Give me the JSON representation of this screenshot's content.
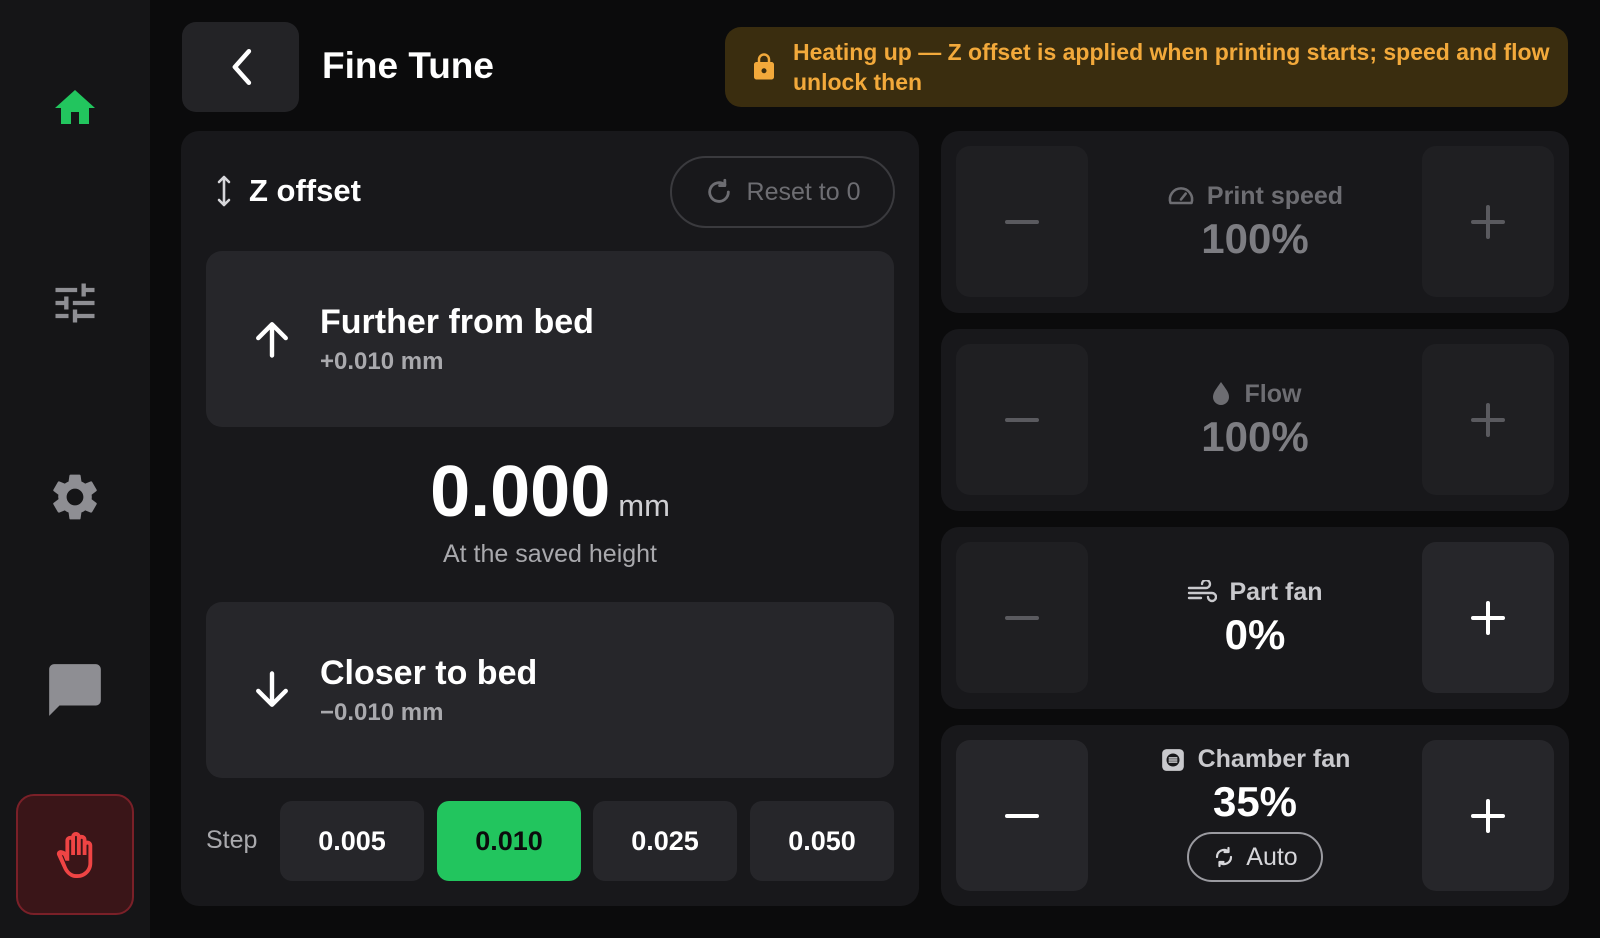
{
  "sidebar": {
    "items": [
      {
        "icon": "home-icon",
        "active": true
      },
      {
        "icon": "sliders-icon"
      },
      {
        "icon": "gear-icon"
      },
      {
        "icon": "chat-icon"
      }
    ],
    "estop_icon": "hand-stop-icon"
  },
  "header": {
    "title": "Fine Tune",
    "banner": "Heating up — Z offset is applied when printing starts; speed and flow unlock then"
  },
  "z_offset": {
    "title": "Z offset",
    "reset_label": "Reset to 0",
    "up": {
      "title": "Further from bed",
      "delta": "+0.010 mm"
    },
    "down": {
      "title": "Closer to bed",
      "delta": "−0.010 mm"
    },
    "value": "0.000",
    "unit": "mm",
    "status": "At the saved height",
    "step_label": "Step",
    "steps": [
      "0.005",
      "0.010",
      "0.025",
      "0.050"
    ],
    "selected_step": "0.010"
  },
  "controls": {
    "print_speed": {
      "label": "Print speed",
      "value": "100%",
      "enabled": false
    },
    "flow": {
      "label": "Flow",
      "value": "100%",
      "enabled": false
    },
    "part_fan": {
      "label": "Part fan",
      "value": "0%",
      "enabled": true
    },
    "chamber_fan": {
      "label": "Chamber fan",
      "value": "35%",
      "enabled": true,
      "mode": "Auto"
    }
  },
  "colors": {
    "accent": "#22c55e",
    "warning": "#f2a93b",
    "danger": "#ef4444"
  }
}
